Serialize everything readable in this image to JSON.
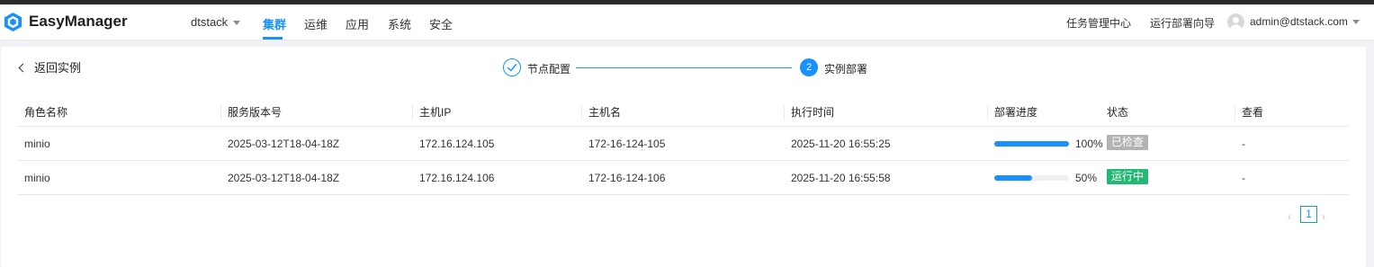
{
  "header": {
    "brand": "EasyManager",
    "tenant": "dtstack",
    "nav": [
      "集群",
      "运维",
      "应用",
      "系统",
      "安全"
    ],
    "active_nav": "集群",
    "task_center": "任务管理中心",
    "deploy_wizard": "运行部署向导",
    "user": "admin@dtstack.com"
  },
  "page": {
    "back_label": "返回实例",
    "steps": [
      {
        "label": "节点配置",
        "status": "done"
      },
      {
        "label": "实例部署",
        "number": "2",
        "status": "current"
      }
    ]
  },
  "table": {
    "columns": [
      "角色名称",
      "服务版本号",
      "主机IP",
      "主机名",
      "执行时间",
      "部署进度",
      "状态",
      "查看"
    ],
    "rows": [
      {
        "role": "minio",
        "version": "2025-03-12T18-04-18Z",
        "ip": "172.16.124.105",
        "hostname": "172-16-124-105",
        "time": "2025-11-20 16:55:25",
        "progress": 100,
        "progress_text": "100%",
        "status": "已检查",
        "status_color": "#b3b3b3",
        "view": "-"
      },
      {
        "role": "minio",
        "version": "2025-03-12T18-04-18Z",
        "ip": "172.16.124.106",
        "hostname": "172-16-124-106",
        "time": "2025-11-20 16:55:58",
        "progress": 50,
        "progress_text": "50%",
        "status": "运行中",
        "status_color": "#23b874",
        "view": "-"
      }
    ]
  },
  "pagination": {
    "current": "1",
    "prev": "‹",
    "next": "›"
  },
  "colors": {
    "accent": "#1890ff"
  }
}
